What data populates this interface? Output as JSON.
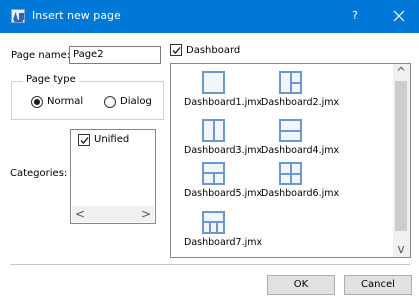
{
  "window": {
    "title": "Insert new page",
    "help_glyph": "?",
    "close_glyph": "×"
  },
  "form": {
    "page_name_label": "Page name:",
    "page_name_value": "Page2",
    "dashboard_label": "Dashboard",
    "dashboard_checked": true
  },
  "page_type": {
    "legend": "Page type",
    "options": [
      {
        "label": "Normal",
        "selected": true
      },
      {
        "label": "Dialog",
        "selected": false
      }
    ]
  },
  "categories": {
    "label": "Categories:",
    "items": [
      {
        "label": "Unified",
        "checked": true
      }
    ],
    "scroll_left": "<",
    "scroll_right": ">"
  },
  "gallery": {
    "items": [
      {
        "name": "Dashboard1.jmx",
        "icon": "layout-single-icon"
      },
      {
        "name": "Dashboard2.jmx",
        "icon": "layout-left-split-icon"
      },
      {
        "name": "Dashboard3.jmx",
        "icon": "layout-two-columns-icon"
      },
      {
        "name": "Dashboard4.jmx",
        "icon": "layout-two-rows-icon"
      },
      {
        "name": "Dashboard5.jmx",
        "icon": "layout-top-split-icon"
      },
      {
        "name": "Dashboard6.jmx",
        "icon": "layout-grid-icon"
      },
      {
        "name": "Dashboard7.jmx",
        "icon": "layout-top-three-columns-icon"
      }
    ],
    "scroll_up": "^",
    "scroll_down": "v"
  },
  "buttons": {
    "ok": "OK",
    "cancel": "Cancel"
  },
  "colors": {
    "titlebar": "#0078d7",
    "layout_icon": "#6e98c8"
  }
}
